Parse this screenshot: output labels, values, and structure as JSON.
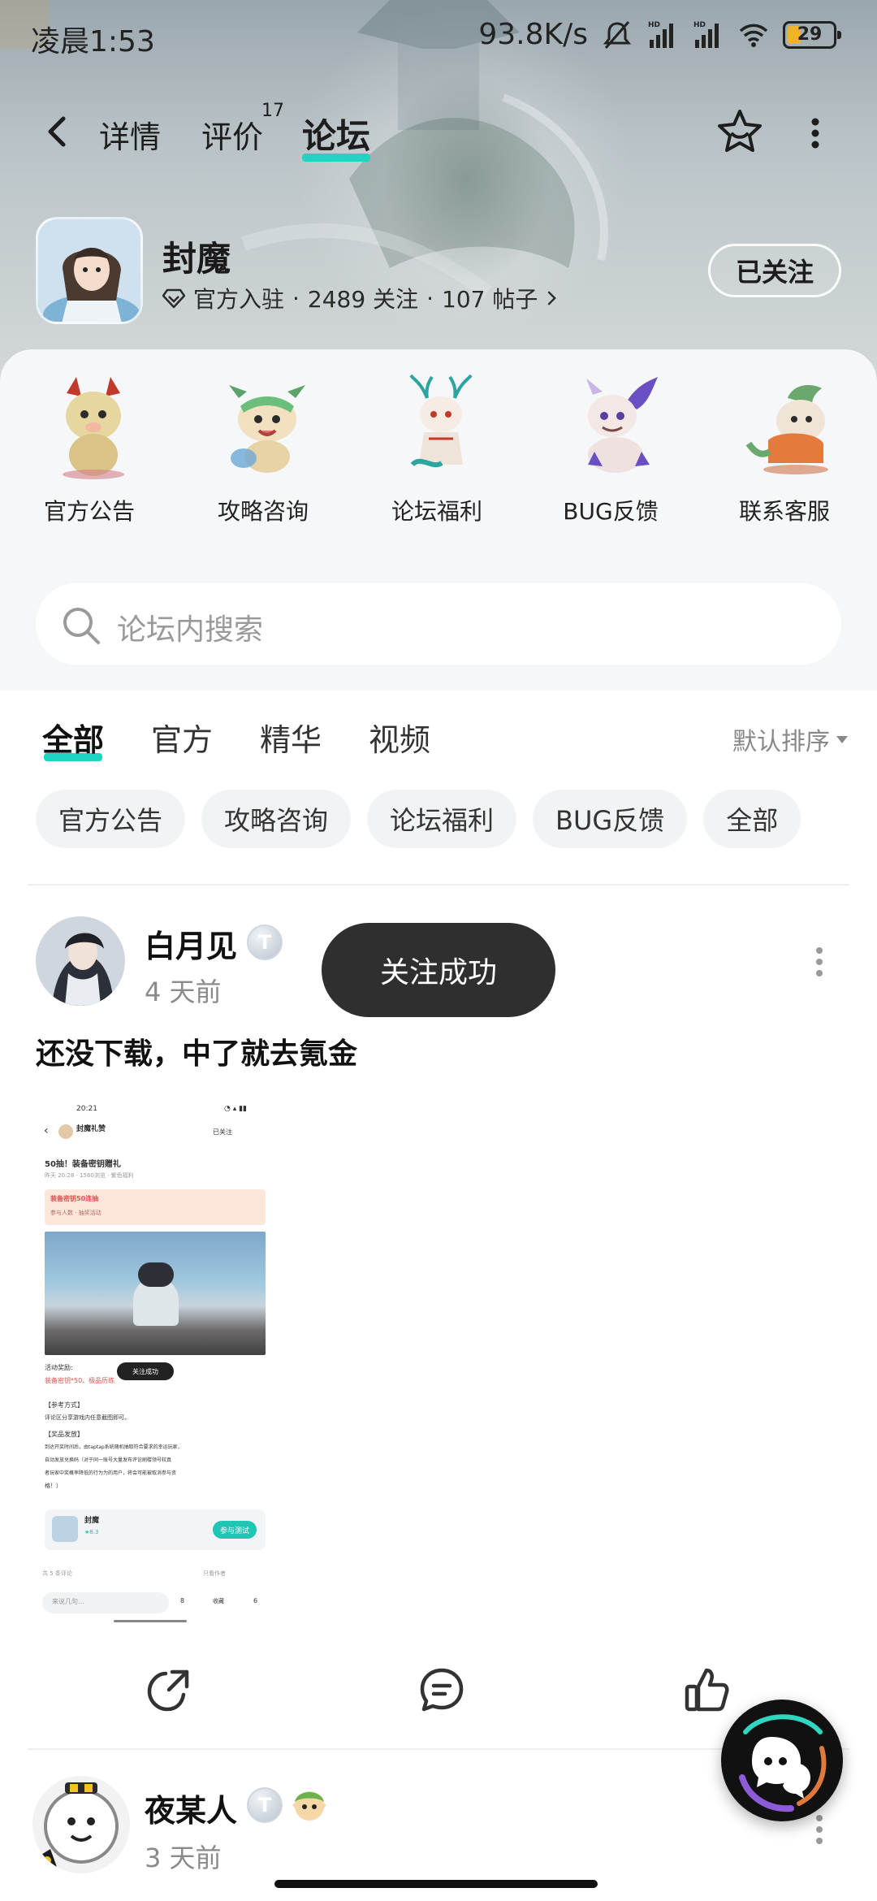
{
  "status_bar": {
    "time": "凌晨1:53",
    "net_speed": "93.8K/s",
    "battery": "29"
  },
  "nav": {
    "tabs": [
      {
        "label": "详情"
      },
      {
        "label": "评价",
        "badge": "17"
      },
      {
        "label": "论坛"
      }
    ],
    "active_tab": "论坛"
  },
  "game": {
    "name": "封魔",
    "badge_text": "官方入驻",
    "followers": "2489 关注",
    "posts": "107 帖子",
    "follow_label": "已关注"
  },
  "categories": [
    {
      "label": "官方公告",
      "icon": "golden-dragon-pet"
    },
    {
      "label": "攻略咨询",
      "icon": "green-dragon-pet"
    },
    {
      "label": "论坛福利",
      "icon": "white-antler-pet"
    },
    {
      "label": "BUG反馈",
      "icon": "purple-winged-pet"
    },
    {
      "label": "联系客服",
      "icon": "orange-lion-pet"
    }
  ],
  "search": {
    "placeholder": "论坛内搜索"
  },
  "filter_tabs": [
    "全部",
    "官方",
    "精华",
    "视频"
  ],
  "sort_label": "默认排序",
  "chips": [
    "官方公告",
    "攻略咨询",
    "论坛福利",
    "BUG反馈",
    "全部"
  ],
  "toast": "关注成功",
  "posts": [
    {
      "author": "白月见",
      "level": "T",
      "time": "4 天前",
      "title": "还没下载，中了就去氪金",
      "screenshot": {
        "time": "20:21",
        "app_title": "封魔礼赞",
        "followed": "已关注",
        "post_title": "50抽！装备密钥赠礼",
        "meta": "昨天 20:28 · 1560浏览 · 紫色福利",
        "banner_title": "装备密钥50连抽",
        "banner_sub": "参与人数 · 抽奖活动",
        "reward_label": "活动奖励:",
        "reward_text": "装备密钥*50、极品历练",
        "toast": "关注成功",
        "sec1": "【参考方式】",
        "sec1_text": "评论区分享游戏内任意截图即可。",
        "sec2": "【奖品发放】",
        "sec2_l1": "到达开奖时间后，由taptap系统随机抽取符合要求的幸运玩家，",
        "sec2_l2": "自动发放兑换码（对于同一账号大量发布评论刷楼领号较真",
        "sec2_l3": "者玩家中奖概率降低的行为为的用户，将会可能被取消参与资",
        "sec2_l4": "格！）",
        "card_name": "封魔",
        "card_rating": "★8.3",
        "card_join": "参与测试",
        "comments": "共 5 条评论",
        "filter": "只看作者",
        "input": "来说几句...",
        "like": "8",
        "fav": "收藏",
        "cmt": "6"
      }
    },
    {
      "author": "夜某人",
      "level": "T",
      "time": "3 天前"
    }
  ],
  "colors": {
    "accent": "#1fd5c2",
    "toast_bg": "#2f2f2f",
    "chip_bg": "#f2f3f4"
  }
}
